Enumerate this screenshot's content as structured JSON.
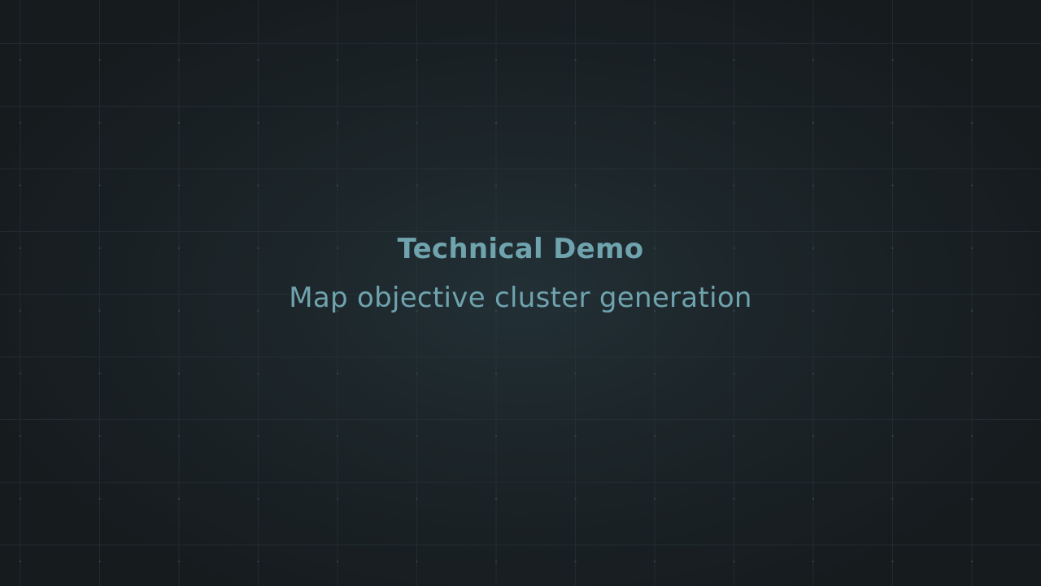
{
  "slide": {
    "title": "Technical Demo",
    "subtitle": "Map objective cluster generation"
  },
  "colors": {
    "background": "#1c2529",
    "grid_line": "#2a363b",
    "text": "#6fa3ad"
  }
}
